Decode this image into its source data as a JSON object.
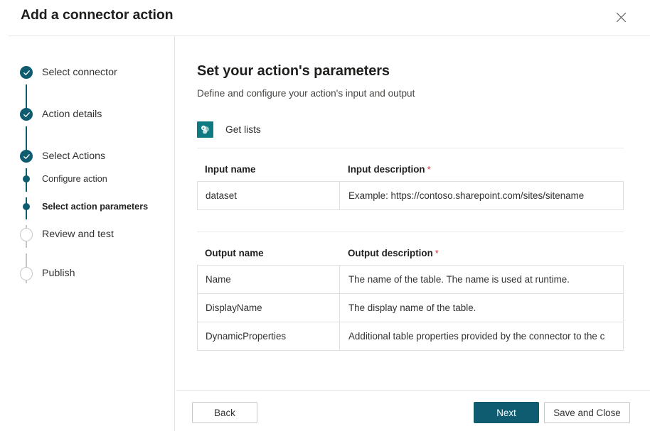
{
  "dialog": {
    "title": "Add a connector action",
    "close_label": "Close"
  },
  "sidebar": {
    "steps": [
      {
        "label": "Select connector",
        "state": "done"
      },
      {
        "label": "Action details",
        "state": "done"
      },
      {
        "label": "Select Actions",
        "state": "done"
      },
      {
        "label": "Configure action",
        "state": "visited"
      },
      {
        "label": "Select action parameters",
        "state": "current"
      },
      {
        "label": "Review and test",
        "state": "pending"
      },
      {
        "label": "Publish",
        "state": "pending"
      }
    ]
  },
  "main": {
    "heading": "Set your action's parameters",
    "subheading": "Define and configure your action's input and output",
    "connector": {
      "name": "Get lists",
      "icon": "sharepoint-icon",
      "icon_color": "#0f7a82"
    },
    "input_table": {
      "columns": [
        {
          "label": "Input name",
          "required": false
        },
        {
          "label": "Input description",
          "required": true,
          "required_mark": "*"
        }
      ],
      "rows": [
        {
          "name": "dataset",
          "description": "Example: https://contoso.sharepoint.com/sites/sitename"
        }
      ]
    },
    "output_table": {
      "columns": [
        {
          "label": "Output name",
          "required": false
        },
        {
          "label": "Output description",
          "required": true,
          "required_mark": "*"
        }
      ],
      "rows": [
        {
          "name": "Name",
          "description": "The name of the table. The name is used at runtime."
        },
        {
          "name": "DisplayName",
          "description": "The display name of the table."
        },
        {
          "name": "DynamicProperties",
          "description": "Additional table properties provided by the connector to the c"
        }
      ]
    }
  },
  "footer": {
    "back_label": "Back",
    "next_label": "Next",
    "save_close_label": "Save and Close"
  },
  "theme": {
    "accent": "#0f5b70",
    "connector_icon": "#0f7a82",
    "required_red": "#d13438",
    "border": "#e1dfdd"
  }
}
